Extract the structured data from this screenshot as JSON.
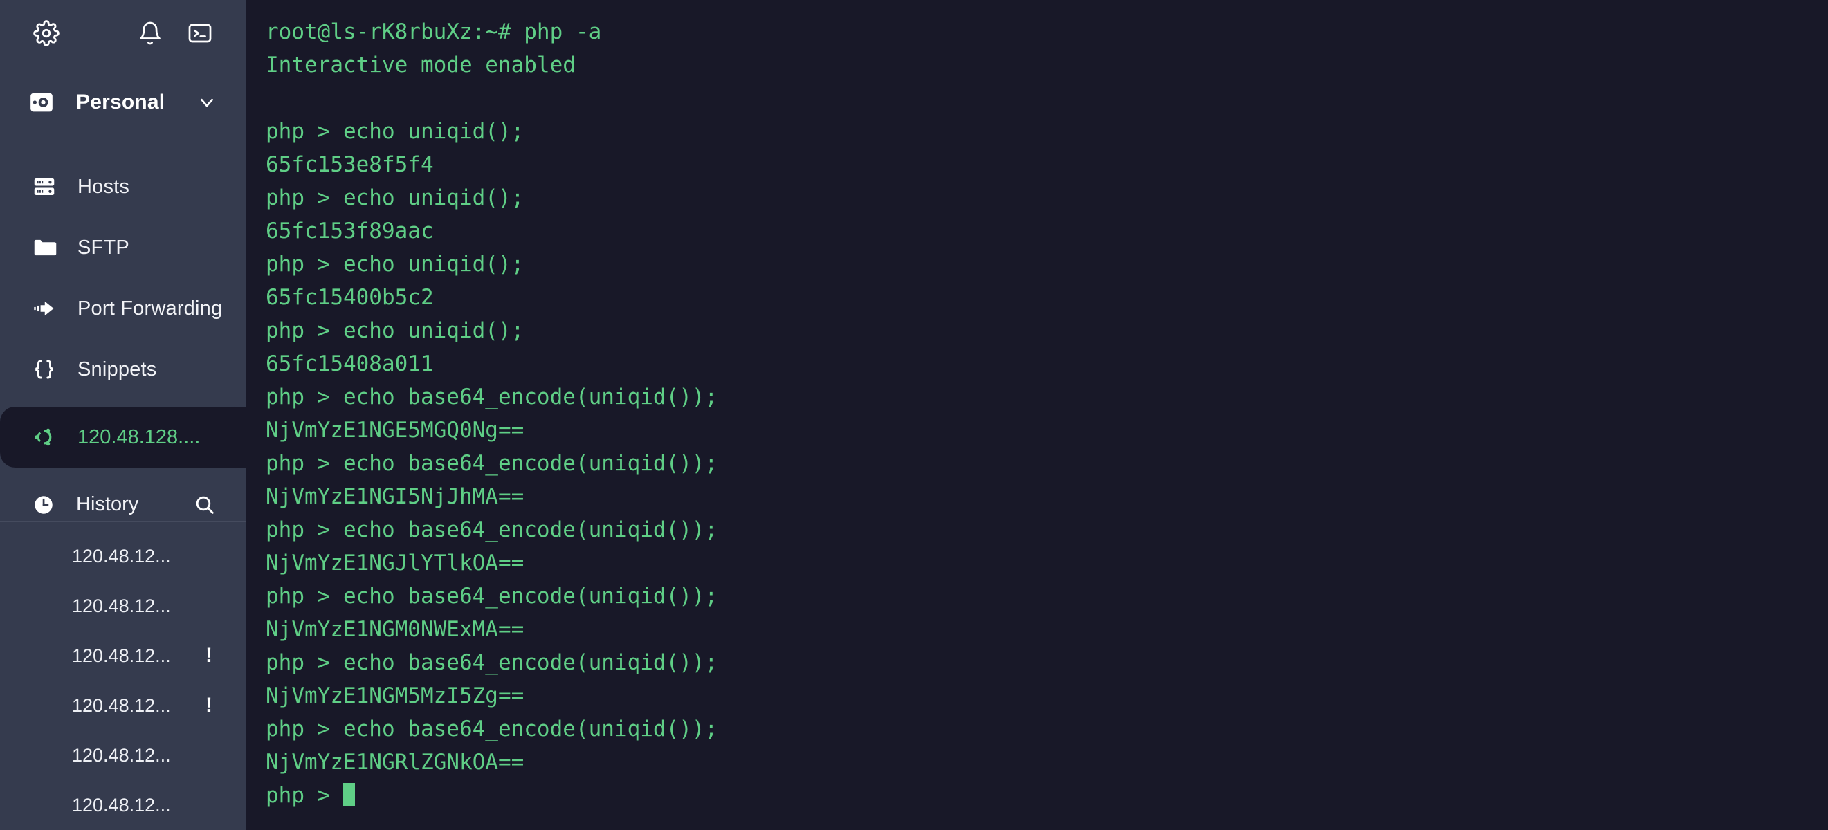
{
  "topbar": {
    "settings_icon": "gear-icon",
    "notifications_icon": "bell-icon",
    "terminal_icon": "terminal-icon"
  },
  "vault": {
    "icon": "safe-icon",
    "label": "Personal",
    "chevron": "chevron-down-icon"
  },
  "nav": {
    "items": [
      {
        "label": "Hosts",
        "icon": "server-icon"
      },
      {
        "label": "SFTP",
        "icon": "folder-icon"
      },
      {
        "label": "Port Forwarding",
        "icon": "forward-arrow-icon"
      },
      {
        "label": "Snippets",
        "icon": "braces-icon"
      }
    ]
  },
  "active_session": {
    "label": "120.48.128....",
    "icon": "ubuntu-icon",
    "accent": "#5fce86"
  },
  "history": {
    "title": "History",
    "icon": "clock-icon",
    "search_icon": "search-icon",
    "items": [
      {
        "label": "120.48.12...",
        "flag": ""
      },
      {
        "label": "120.48.12...",
        "flag": ""
      },
      {
        "label": "120.48.12...",
        "flag": "!"
      },
      {
        "label": "120.48.12...",
        "flag": "!"
      },
      {
        "label": "120.48.12...",
        "flag": ""
      },
      {
        "label": "120.48.12...",
        "flag": ""
      }
    ]
  },
  "terminal": {
    "background": "#181828",
    "foreground": "#5fce86",
    "prompt": "php > ",
    "lines": [
      "root@ls-rK8rbuXz:~# php -a",
      "Interactive mode enabled",
      "",
      "php > echo uniqid();",
      "65fc153e8f5f4",
      "php > echo uniqid();",
      "65fc153f89aac",
      "php > echo uniqid();",
      "65fc15400b5c2",
      "php > echo uniqid();",
      "65fc15408a011",
      "php > echo base64_encode(uniqid());",
      "NjVmYzE1NGE5MGQ0Ng==",
      "php > echo base64_encode(uniqid());",
      "NjVmYzE1NGI5NjJhMA==",
      "php > echo base64_encode(uniqid());",
      "NjVmYzE1NGJlYTlkOA==",
      "php > echo base64_encode(uniqid());",
      "NjVmYzE1NGM0NWExMA==",
      "php > echo base64_encode(uniqid());",
      "NjVmYzE1NGM5MzI5Zg==",
      "php > echo base64_encode(uniqid());",
      "NjVmYzE1NGRlZGNkOA=="
    ],
    "cursor_line": "php > "
  }
}
